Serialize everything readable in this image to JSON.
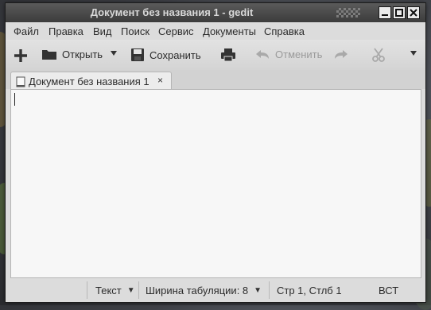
{
  "window": {
    "title": "Документ без названия 1 - gedit"
  },
  "menu": {
    "items": [
      "Файл",
      "Правка",
      "Вид",
      "Поиск",
      "Сервис",
      "Документы",
      "Справка"
    ]
  },
  "toolbar": {
    "open_label": "Открыть",
    "save_label": "Сохранить",
    "undo_label": "Отменить"
  },
  "tab": {
    "label": "Документ без названия 1",
    "close_glyph": "×"
  },
  "editor": {
    "content": ""
  },
  "statusbar": {
    "language": "Текст",
    "tab_width": "Ширина табуляции:  8",
    "position": "Стр 1, Стлб 1",
    "mode": "ВСТ"
  },
  "colors": {
    "titlebar": "#3c3c3c",
    "chrome": "#dcdcdc",
    "editor_bg": "#f7f7f7"
  }
}
